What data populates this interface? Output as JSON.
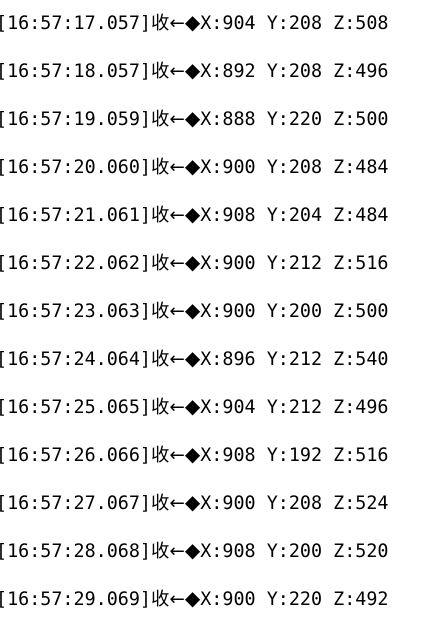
{
  "log": {
    "direction_label": "收",
    "arrow_glyph": "←",
    "marker_glyph": "◆",
    "entries": [
      {
        "time": "[16:57:17.057]",
        "x": "X:904",
        "y": "Y:208",
        "z": "Z:508"
      },
      {
        "time": "[16:57:18.057]",
        "x": "X:892",
        "y": "Y:208",
        "z": "Z:496"
      },
      {
        "time": "[16:57:19.059]",
        "x": "X:888",
        "y": "Y:220",
        "z": "Z:500"
      },
      {
        "time": "[16:57:20.060]",
        "x": "X:900",
        "y": "Y:208",
        "z": "Z:484"
      },
      {
        "time": "[16:57:21.061]",
        "x": "X:908",
        "y": "Y:204",
        "z": "Z:484"
      },
      {
        "time": "[16:57:22.062]",
        "x": "X:900",
        "y": "Y:212",
        "z": "Z:516"
      },
      {
        "time": "[16:57:23.063]",
        "x": "X:900",
        "y": "Y:200",
        "z": "Z:500"
      },
      {
        "time": "[16:57:24.064]",
        "x": "X:896",
        "y": "Y:212",
        "z": "Z:540"
      },
      {
        "time": "[16:57:25.065]",
        "x": "X:904",
        "y": "Y:212",
        "z": "Z:496"
      },
      {
        "time": "[16:57:26.066]",
        "x": "X:908",
        "y": "Y:192",
        "z": "Z:516"
      },
      {
        "time": "[16:57:27.067]",
        "x": "X:900",
        "y": "Y:208",
        "z": "Z:524"
      },
      {
        "time": "[16:57:28.068]",
        "x": "X:908",
        "y": "Y:200",
        "z": "Z:520"
      },
      {
        "time": "[16:57:29.069]",
        "x": "X:900",
        "y": "Y:220",
        "z": "Z:492"
      }
    ]
  }
}
